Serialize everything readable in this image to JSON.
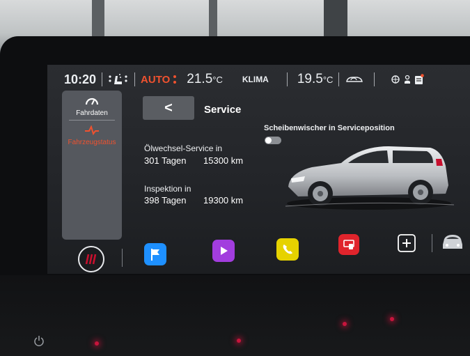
{
  "status_bar": {
    "time": "10:20",
    "mode": "AUTO",
    "temp_left": "21.5",
    "temp_left_unit": "°C",
    "climate_label": "KLIMA",
    "temp_right": "19.5",
    "temp_right_unit": "°C"
  },
  "sidebar": {
    "items": [
      {
        "label": "Fahrdaten",
        "icon": "gauge-icon",
        "active": false
      },
      {
        "label": "Fahrzeugstatus",
        "icon": "pulse-icon",
        "active": true
      }
    ]
  },
  "header": {
    "back_label": "<",
    "title": "Service"
  },
  "service": {
    "oil": {
      "label": "Ölwechsel-Service in",
      "days": "301 Tagen",
      "km": "15300 km"
    },
    "inspection": {
      "label": "Inspektion in",
      "days": "398 Tagen",
      "km": "19300 km"
    },
    "wiper": {
      "label": "Scheibenwischer in Serviceposition",
      "enabled": false
    }
  },
  "dock": {
    "items": [
      {
        "icon": "brand-menu-icon",
        "color": "#c8102e"
      },
      {
        "icon": "navigation-flag-icon",
        "color": "#1e90ff"
      },
      {
        "icon": "media-play-icon",
        "color": "#a23dde"
      },
      {
        "icon": "phone-icon",
        "color": "#e6d200"
      },
      {
        "icon": "app-connect-icon",
        "color": "#e0242c"
      },
      {
        "icon": "add-icon",
        "color": "#ffffff"
      },
      {
        "icon": "vehicle-icon",
        "color": "#cfd2d6"
      }
    ]
  },
  "colors": {
    "accent": "#f0522f",
    "text": "#eceff2",
    "panel": "#55585e"
  }
}
